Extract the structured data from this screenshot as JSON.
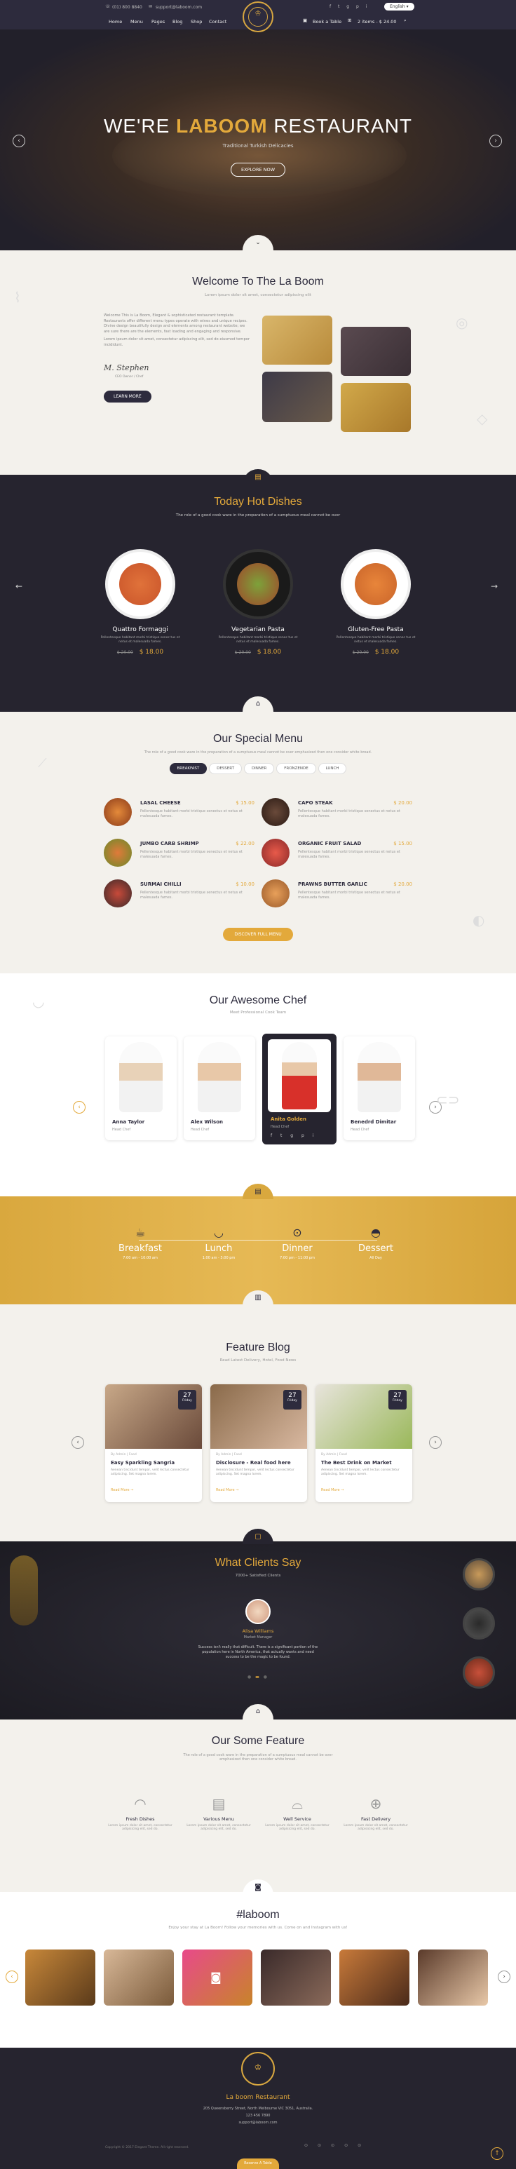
{
  "topbar": {
    "phone": "(01) 800 8840",
    "email": "support@laboom.com",
    "book_table": "Book a Table",
    "cart": "2 items - $ 24.00",
    "language": "English"
  },
  "nav": {
    "items": [
      "Home",
      "Menu",
      "Pages",
      "Blog",
      "Shop",
      "Contact"
    ]
  },
  "hero": {
    "title_pre": "WE'RE",
    "title_gold": "LABOOM",
    "title_post": "RESTAURANT",
    "subtitle": "Traditional Turkish Delicacies",
    "button": "EXPLORE NOW"
  },
  "welcome": {
    "title": "Welcome To The La Boom",
    "subtitle": "Lorem ipsum dolor sit amet, consectetur adipiscing elit",
    "body1": "Welcome This is La Boom, Elegant & sophisticated restaurant template. Restaurants offer different menu types operate with wines and unique recipes. Divine design beautifully design and elements among restaurant website; we are sure there are the elements, fast loading and engaging and responsive.",
    "body2": "Lorem ipsum dolor sit amet, consectetur adipiscing elit, sed do eiusmod tempor incididunt.",
    "signature": "M. Stephen",
    "signer_role": "CEO Owner / Chef",
    "button": "LEARN MORE"
  },
  "hot": {
    "title": "Today Hot Dishes",
    "subtitle": "The role of a good cook ware in the preparation of a sumptuous meal cannot be over",
    "items": [
      {
        "name": "Quattro Formaggi",
        "desc": "Pellentesque habitant morbi tristique senec tus et netus et malesuada fames.",
        "old": "$ 20.00",
        "price": "$ 18.00"
      },
      {
        "name": "Vegetarian Pasta",
        "desc": "Pellentesque habitant morbi tristique senec tus et netus et malesuada fames.",
        "old": "$ 20.00",
        "price": "$ 18.00"
      },
      {
        "name": "Gluten-Free Pasta",
        "desc": "Pellentesque habitant morbi tristique senec tus et netus et malesuada fames.",
        "old": "$ 20.00",
        "price": "$ 18.00"
      }
    ]
  },
  "menu": {
    "title": "Our Special Menu",
    "subtitle": "The role of a good cook ware in the preparation of a sumptuous meal cannot be over emphasized then one consider white bread.",
    "tabs": [
      "BREAKFAST",
      "DESSERT",
      "DINNER",
      "FRONZENDE",
      "LUNCH"
    ],
    "items": [
      {
        "name": "LASAL CHEESE",
        "price": "$ 15.00",
        "desc": "Pellentesque habitant morbi tristique senectus et netus et malesuada fames."
      },
      {
        "name": "CAPO STEAK",
        "price": "$ 20.00",
        "desc": "Pellentesque habitant morbi tristique senectus et netus et malesuada fames."
      },
      {
        "name": "JUMBO CARB SHRIMP",
        "price": "$ 22.00",
        "desc": "Pellentesque habitant morbi tristique senectus et netus et malesuada fames."
      },
      {
        "name": "ORGANIC FRUIT SALAD",
        "price": "$ 15.00",
        "desc": "Pellentesque habitant morbi tristique senectus et netus et malesuada fames."
      },
      {
        "name": "SURMAI CHILLI",
        "price": "$ 10.00",
        "desc": "Pellentesque habitant morbi tristique senectus et netus et malesuada fames."
      },
      {
        "name": "PRAWNS BUTTER GARLIC",
        "price": "$ 20.00",
        "desc": "Pellentesque habitant morbi tristique senectus et netus et malesuada fames."
      }
    ],
    "button": "DISCOVER FULL MENU"
  },
  "chef": {
    "title": "Our Awesome Chef",
    "subtitle": "Meet Professional Cook Team",
    "items": [
      {
        "name": "Anna Taylor",
        "role": "Head Chef"
      },
      {
        "name": "Alex Wilson",
        "role": "Head Chef"
      },
      {
        "name": "Anita Golden",
        "role": "Head Chef"
      },
      {
        "name": "Benedrd Dimitar",
        "role": "Head Chef"
      }
    ]
  },
  "hours": {
    "items": [
      {
        "name": "Breakfast",
        "time": "7:00 am - 10:00 am"
      },
      {
        "name": "Lunch",
        "time": "1:00 am - 3:00 pm"
      },
      {
        "name": "Dinner",
        "time": "7:00 pm - 11:00 pm"
      },
      {
        "name": "Dessert",
        "time": "All Day"
      }
    ]
  },
  "blog": {
    "title": "Feature Blog",
    "subtitle": "Read Latest Delivery, Hotel, Food News",
    "items": [
      {
        "day": "27",
        "dow": "Friday",
        "meta": "By Admin  |  Food",
        "title": "Easy Sparkling Sangria",
        "desc": "Aenean tincidunt tempor, velit lectus consectetur adipiscing. Set magna lorem.",
        "more": "Read More"
      },
      {
        "day": "27",
        "dow": "Friday",
        "meta": "By Admin  |  Food",
        "title": "Disclosure - Real food here",
        "desc": "Aenean tincidunt tempor, velit lectus consectetur adipiscing. Set magna lorem.",
        "more": "Read More"
      },
      {
        "day": "27",
        "dow": "Friday",
        "meta": "By Admin  |  Food",
        "title": "The Best Drink on Market",
        "desc": "Aenean tincidunt tempor, velit lectus consectetur adipiscing. Set magna lorem.",
        "more": "Read More"
      }
    ]
  },
  "testimonial": {
    "title": "What Clients Say",
    "subtitle": "7000+ Satisfied Clients",
    "name": "Alisa Williams",
    "role": "Market Manager",
    "quote": "Success isn't really that difficult. There is a significant portion of the population here in North America, that actually wants and need success to be the magic to be found."
  },
  "features": {
    "title": "Our Some Feature",
    "subtitle": "The role of a good cook ware in the preparation of a sumptuous meal cannot be over emphasized then one consider white bread.",
    "items": [
      {
        "name": "Fresh Dishes",
        "desc": "Lorem ipsum dolor sit amet, consectetur adipisicing elit, sed do."
      },
      {
        "name": "Various Menu",
        "desc": "Lorem ipsum dolor sit amet, consectetur adipisicing elit, sed do."
      },
      {
        "name": "Well Service",
        "desc": "Lorem ipsum dolor sit amet, consectetur adipisicing elit, sed do."
      },
      {
        "name": "Fast Delivery",
        "desc": "Lorem ipsum dolor sit amet, consectetur adipisicing elit, sed do."
      }
    ]
  },
  "instagram": {
    "title": "#laboom",
    "subtitle": "Enjoy your stay at La Boom! Follow your memories with us. Come on and Instagram with us!"
  },
  "footer": {
    "title": "La boom Restaurant",
    "address": "205 Queensberry Street, North Melbourne VIC 3051, Australia.",
    "phone": "123 456 7890",
    "email": "support@laboom.com",
    "copyright": "Copyright © 2017 Elegant Theme. All right reserved.",
    "reserve": "Reserve A Table"
  },
  "colors": {
    "accent": "#e3a93b",
    "dark": "#2d2b3d"
  }
}
